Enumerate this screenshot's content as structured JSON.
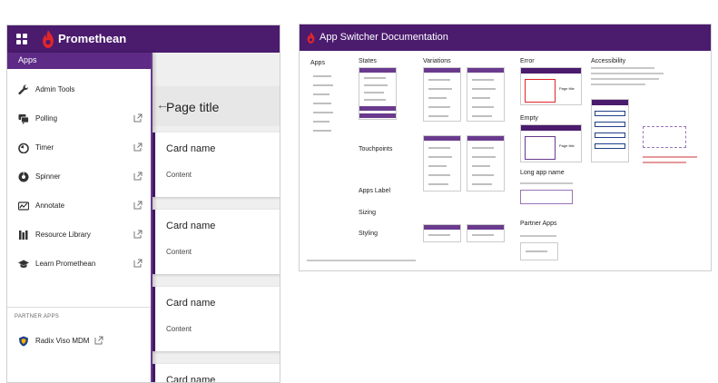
{
  "left": {
    "brand": "Promethean",
    "page_title": "Page title",
    "drawer": {
      "title": "Apps",
      "items": [
        {
          "label": "Admin Tools",
          "icon": "wrench-icon",
          "external": false
        },
        {
          "label": "Polling",
          "icon": "chat-icon",
          "external": true
        },
        {
          "label": "Timer",
          "icon": "timer-icon",
          "external": true
        },
        {
          "label": "Spinner",
          "icon": "spinner-icon",
          "external": true
        },
        {
          "label": "Annotate",
          "icon": "annotate-icon",
          "external": true
        },
        {
          "label": "Resource Library",
          "icon": "library-icon",
          "external": true
        },
        {
          "label": "Learn Promethean",
          "icon": "graduation-cap-icon",
          "external": true
        }
      ],
      "partner_title": "PARTNER APPS",
      "partner_items": [
        {
          "label": "Radix Viso MDM",
          "icon": "radix-shield-icon",
          "external": true
        }
      ]
    },
    "cards": [
      {
        "name": "Card name",
        "content": "Content"
      },
      {
        "name": "Card name",
        "content": "Content"
      },
      {
        "name": "Card name",
        "content": "Content"
      },
      {
        "name": "Card name",
        "content": ""
      }
    ]
  },
  "right": {
    "title": "App Switcher Documentation",
    "sections": {
      "apps": "Apps",
      "states": "States",
      "variations": "Variations",
      "error": "Error",
      "accessibility": "Accessibility",
      "empty": "Empty",
      "touchpoints": "Touchpoints",
      "apps_label": "Apps Label",
      "sizing": "Sizing",
      "styling": "Styling",
      "long_app_name": "Long app name",
      "partner_apps": "Partner Apps"
    },
    "mini_page_title": "Page title"
  },
  "colors": {
    "brand_purple": "#4b1b6e",
    "accent_purple": "#6a3a8e",
    "brand_red": "#e0262b"
  }
}
